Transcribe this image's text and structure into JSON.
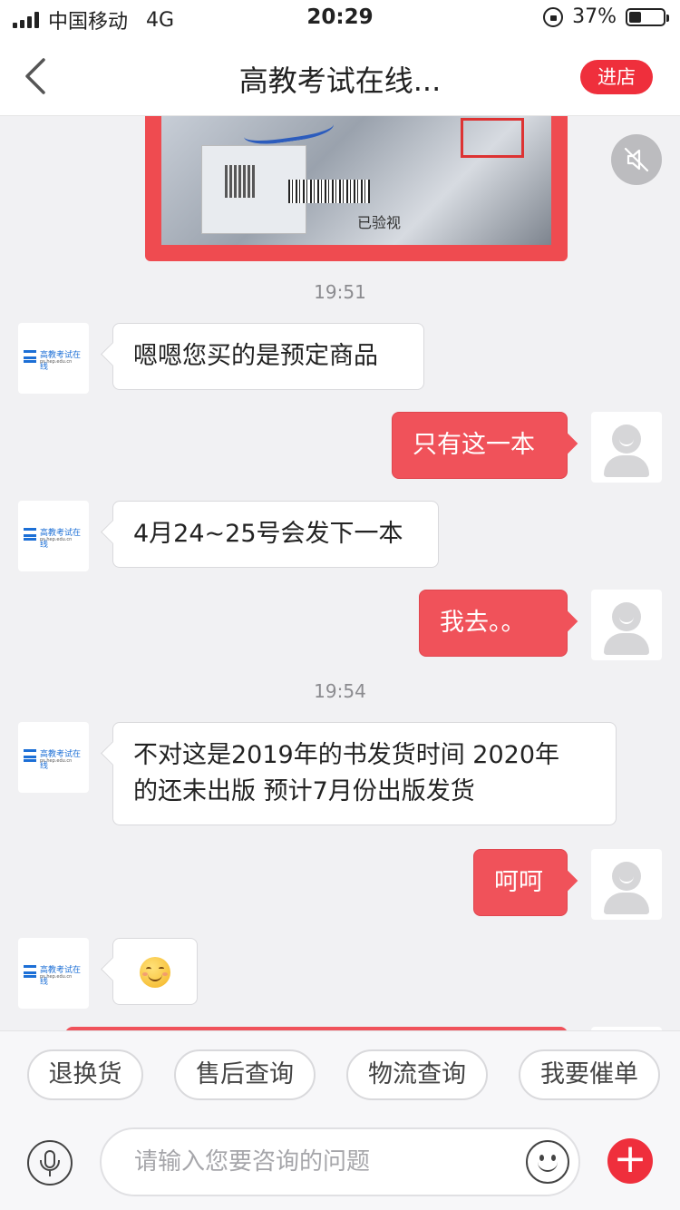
{
  "status_bar": {
    "carrier": "中国移动",
    "network": "4G",
    "time": "20:29",
    "battery_percent": "37%",
    "battery_level": 0.37
  },
  "nav": {
    "title": "高教考试在线...",
    "enter_store_label": "进店"
  },
  "image_message": {
    "verified_stamp_text": "已验视"
  },
  "timestamps": [
    "19:51",
    "19:54"
  ],
  "shop_logo": {
    "text": "高教考试在线",
    "url": "ps.hep.edu.cn"
  },
  "messages": [
    {
      "side": "left",
      "text": "嗯嗯您买的是预定商品"
    },
    {
      "side": "right",
      "text": "只有这一本"
    },
    {
      "side": "left",
      "text": "4月24~25号会发下一本"
    },
    {
      "side": "right",
      "text": "我去。。"
    },
    {
      "side": "left",
      "text_line1": "不对这是2019年的书发货时间 2020年",
      "text_line2": "的还未出版 预计7月份出版发货"
    },
    {
      "side": "right",
      "text": "呵呵"
    },
    {
      "side": "left",
      "emoji": "smile-emoji"
    }
  ],
  "quick_actions": [
    "退换货",
    "售后查询",
    "物流查询",
    "我要催单"
  ],
  "input": {
    "placeholder": "请输入您要咨询的问题"
  },
  "colors": {
    "accent": "#ef2f3c",
    "bubble_right": "#f0525a",
    "background": "#f1f1f3"
  },
  "icons": [
    "signal-icon",
    "rotation-lock-icon",
    "battery-icon",
    "back-chevron-icon",
    "mute-speaker-icon",
    "microphone-icon",
    "emoji-icon",
    "plus-icon"
  ]
}
